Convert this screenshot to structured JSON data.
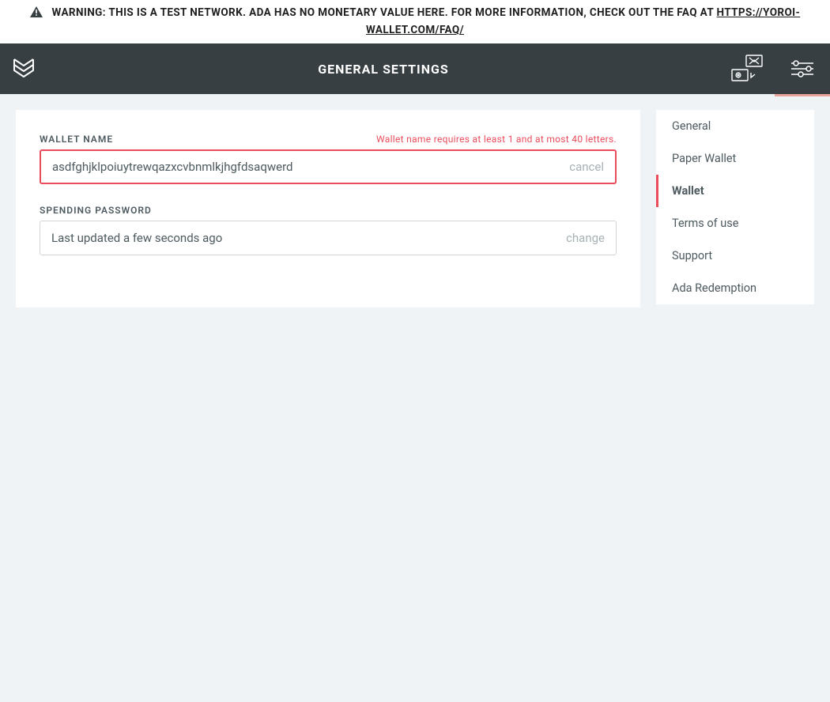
{
  "warning": {
    "text": "WARNING: THIS IS A TEST NETWORK. ADA HAS NO MONETARY VALUE HERE. FOR MORE INFORMATION, CHECK OUT THE FAQ AT ",
    "link_text": "HTTPS://YOROI-WALLET.COM/FAQ/"
  },
  "header": {
    "title": "GENERAL SETTINGS"
  },
  "wallet_name": {
    "label": "WALLET NAME",
    "error": "Wallet name requires at least 1 and at most 40 letters.",
    "value": "asdfghjklpoiuytrewqazxcvbnmlkjhgfdsaqwerd",
    "action": "cancel"
  },
  "spending_password": {
    "label": "SPENDING PASSWORD",
    "status": "Last updated a few seconds ago",
    "action": "change"
  },
  "sidebar": {
    "items": [
      {
        "label": "General",
        "active": false
      },
      {
        "label": "Paper Wallet",
        "active": false
      },
      {
        "label": "Wallet",
        "active": true
      },
      {
        "label": "Terms of use",
        "active": false
      },
      {
        "label": "Support",
        "active": false
      },
      {
        "label": "Ada Redemption",
        "active": false
      }
    ]
  }
}
